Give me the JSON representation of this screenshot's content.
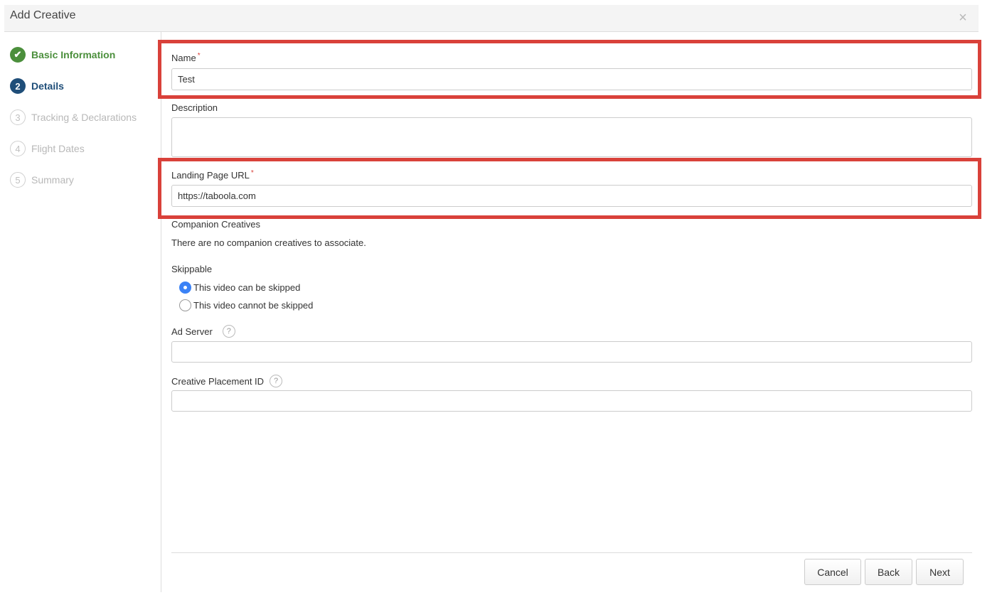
{
  "dialog": {
    "title": "Add Creative",
    "close_glyph": "×"
  },
  "steps": [
    {
      "number": "✔",
      "label": "Basic Information",
      "state": "done"
    },
    {
      "number": "2",
      "label": "Details",
      "state": "active"
    },
    {
      "number": "3",
      "label": "Tracking & Declarations",
      "state": "pending"
    },
    {
      "number": "4",
      "label": "Flight Dates",
      "state": "pending"
    },
    {
      "number": "5",
      "label": "Summary",
      "state": "pending"
    }
  ],
  "form": {
    "name": {
      "label": "Name",
      "required_mark": "*",
      "value": "Test"
    },
    "description": {
      "label": "Description",
      "value": ""
    },
    "landing_url": {
      "label": "Landing Page URL",
      "required_mark": "*",
      "value": "https://taboola.com"
    },
    "companion": {
      "label": "Companion Creatives",
      "text": "There are no companion creatives to associate."
    },
    "skippable": {
      "label": "Skippable",
      "options": [
        {
          "label": "This video can be skipped",
          "checked": true
        },
        {
          "label": "This video cannot be skipped",
          "checked": false
        }
      ]
    },
    "ad_server": {
      "label": "Ad Server",
      "help": "?",
      "value": ""
    },
    "placement_id": {
      "label": "Creative Placement ID",
      "help": "?",
      "value": ""
    }
  },
  "buttons": {
    "cancel": "Cancel",
    "back": "Back",
    "next": "Next"
  },
  "colors": {
    "highlight": "#d9413a",
    "done": "#4b8f3c",
    "active": "#1f4e79",
    "radio_selected": "#3b82f6"
  }
}
